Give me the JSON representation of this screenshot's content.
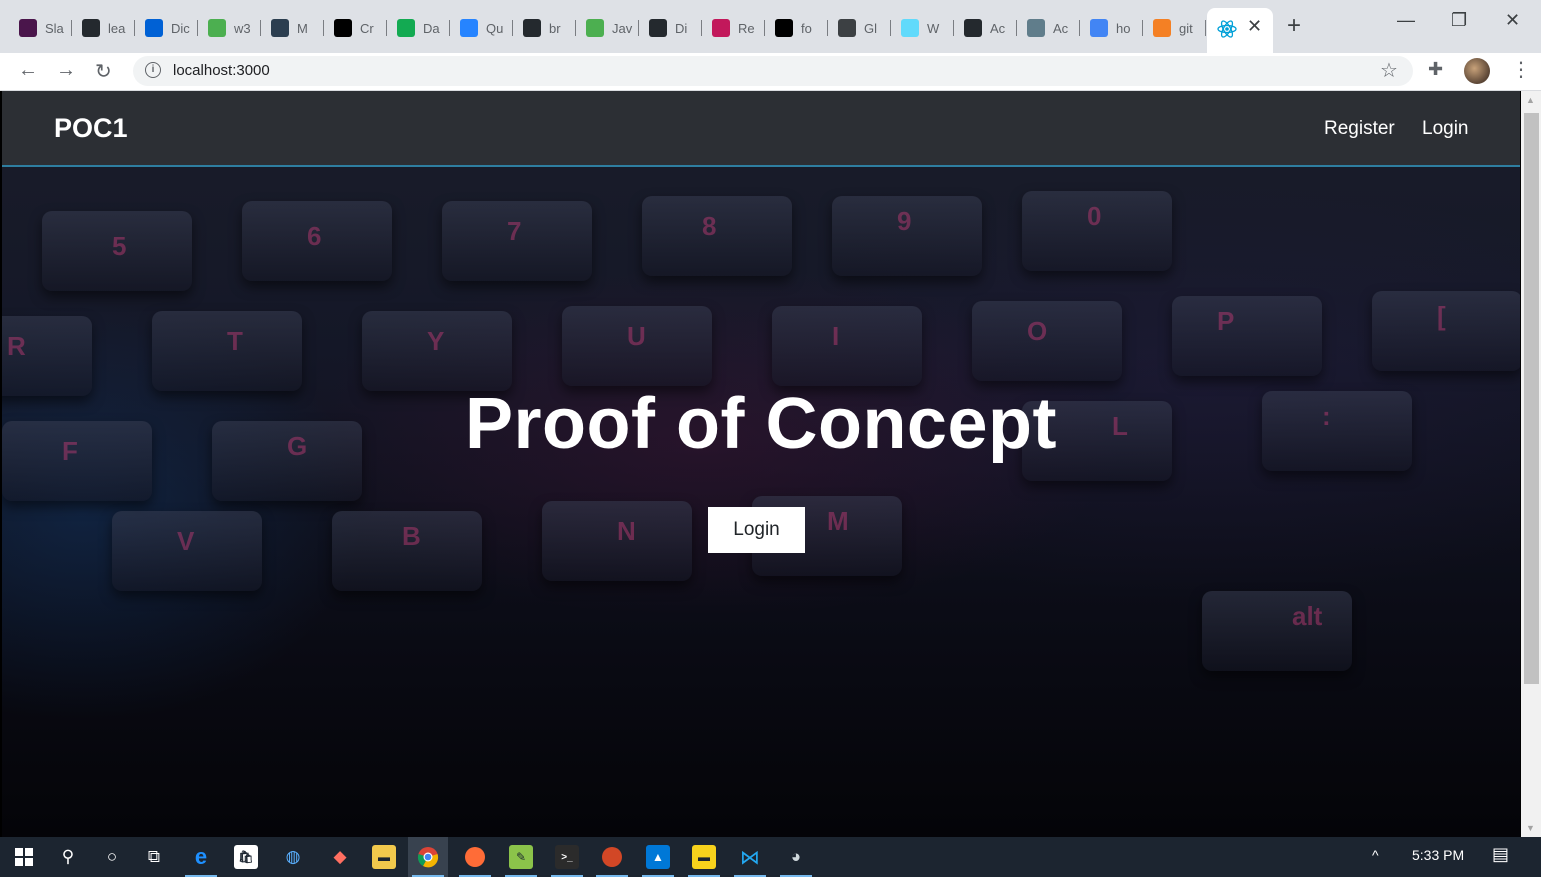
{
  "browser": {
    "tabs": [
      {
        "title": "Sla",
        "icon": "slack-icon",
        "color": "#4a154b"
      },
      {
        "title": "lea",
        "icon": "github-icon",
        "color": "#24292e"
      },
      {
        "title": "Dic",
        "icon": "box-icon",
        "color": "#0061d5"
      },
      {
        "title": "w3",
        "icon": "w3-icon",
        "color": "#4caf50"
      },
      {
        "title": "M",
        "icon": "v-icon",
        "color": "#2c3e50"
      },
      {
        "title": "Cr",
        "icon": "medium-icon",
        "color": "#000000"
      },
      {
        "title": "Da",
        "icon": "mongodb-leaf-icon",
        "color": "#13aa52"
      },
      {
        "title": "Qu",
        "icon": "cloud-icon",
        "color": "#2684ff"
      },
      {
        "title": "br",
        "icon": "github-icon",
        "color": "#24292e"
      },
      {
        "title": "Jav",
        "icon": "w3-icon",
        "color": "#4caf50"
      },
      {
        "title": "Di",
        "icon": "github-icon",
        "color": "#24292e"
      },
      {
        "title": "Re",
        "icon": "dots-icon",
        "color": "#c2185b"
      },
      {
        "title": "fo",
        "icon": "puzzle-icon",
        "color": "#000000"
      },
      {
        "title": "Gl",
        "icon": "globe-icon",
        "color": "#3c4043"
      },
      {
        "title": "W",
        "icon": "react-icon",
        "color": "#61dafb"
      },
      {
        "title": "Ac",
        "icon": "github-icon",
        "color": "#24292e"
      },
      {
        "title": "Ac",
        "icon": "image-icon",
        "color": "#607d8b"
      },
      {
        "title": "ho",
        "icon": "google-icon",
        "color": "#4285f4"
      },
      {
        "title": "git",
        "icon": "stackoverflow-icon",
        "color": "#f48024"
      }
    ],
    "active_tab": {
      "icon": "react-icon",
      "close": "✕"
    },
    "new_tab": "+",
    "window_controls": {
      "minimize": "—",
      "restore": "❐",
      "close": "✕"
    },
    "url": "localhost:3000",
    "info_icon": "i"
  },
  "page": {
    "brand": "POC1",
    "nav": {
      "register": "Register",
      "login": "Login"
    },
    "hero": {
      "title": "Proof of Concept",
      "button": "Login"
    },
    "keys": [
      {
        "label": "5"
      },
      {
        "label": "6"
      },
      {
        "label": "7"
      },
      {
        "label": "8"
      },
      {
        "label": "9"
      },
      {
        "label": "0"
      },
      {
        "label": "R"
      },
      {
        "label": "T"
      },
      {
        "label": "Y"
      },
      {
        "label": "U"
      },
      {
        "label": "I"
      },
      {
        "label": "O"
      },
      {
        "label": "P"
      },
      {
        "label": "["
      },
      {
        "label": "F"
      },
      {
        "label": "G"
      },
      {
        "label": "L"
      },
      {
        "label": ":"
      },
      {
        "label": "V"
      },
      {
        "label": "B"
      },
      {
        "label": "N"
      },
      {
        "label": "M"
      },
      {
        "label": "alt"
      }
    ],
    "accent": "#2e7ea0"
  },
  "taskbar": {
    "time": "5:33 PM",
    "tray_chevron": "^",
    "notification": "▤"
  }
}
